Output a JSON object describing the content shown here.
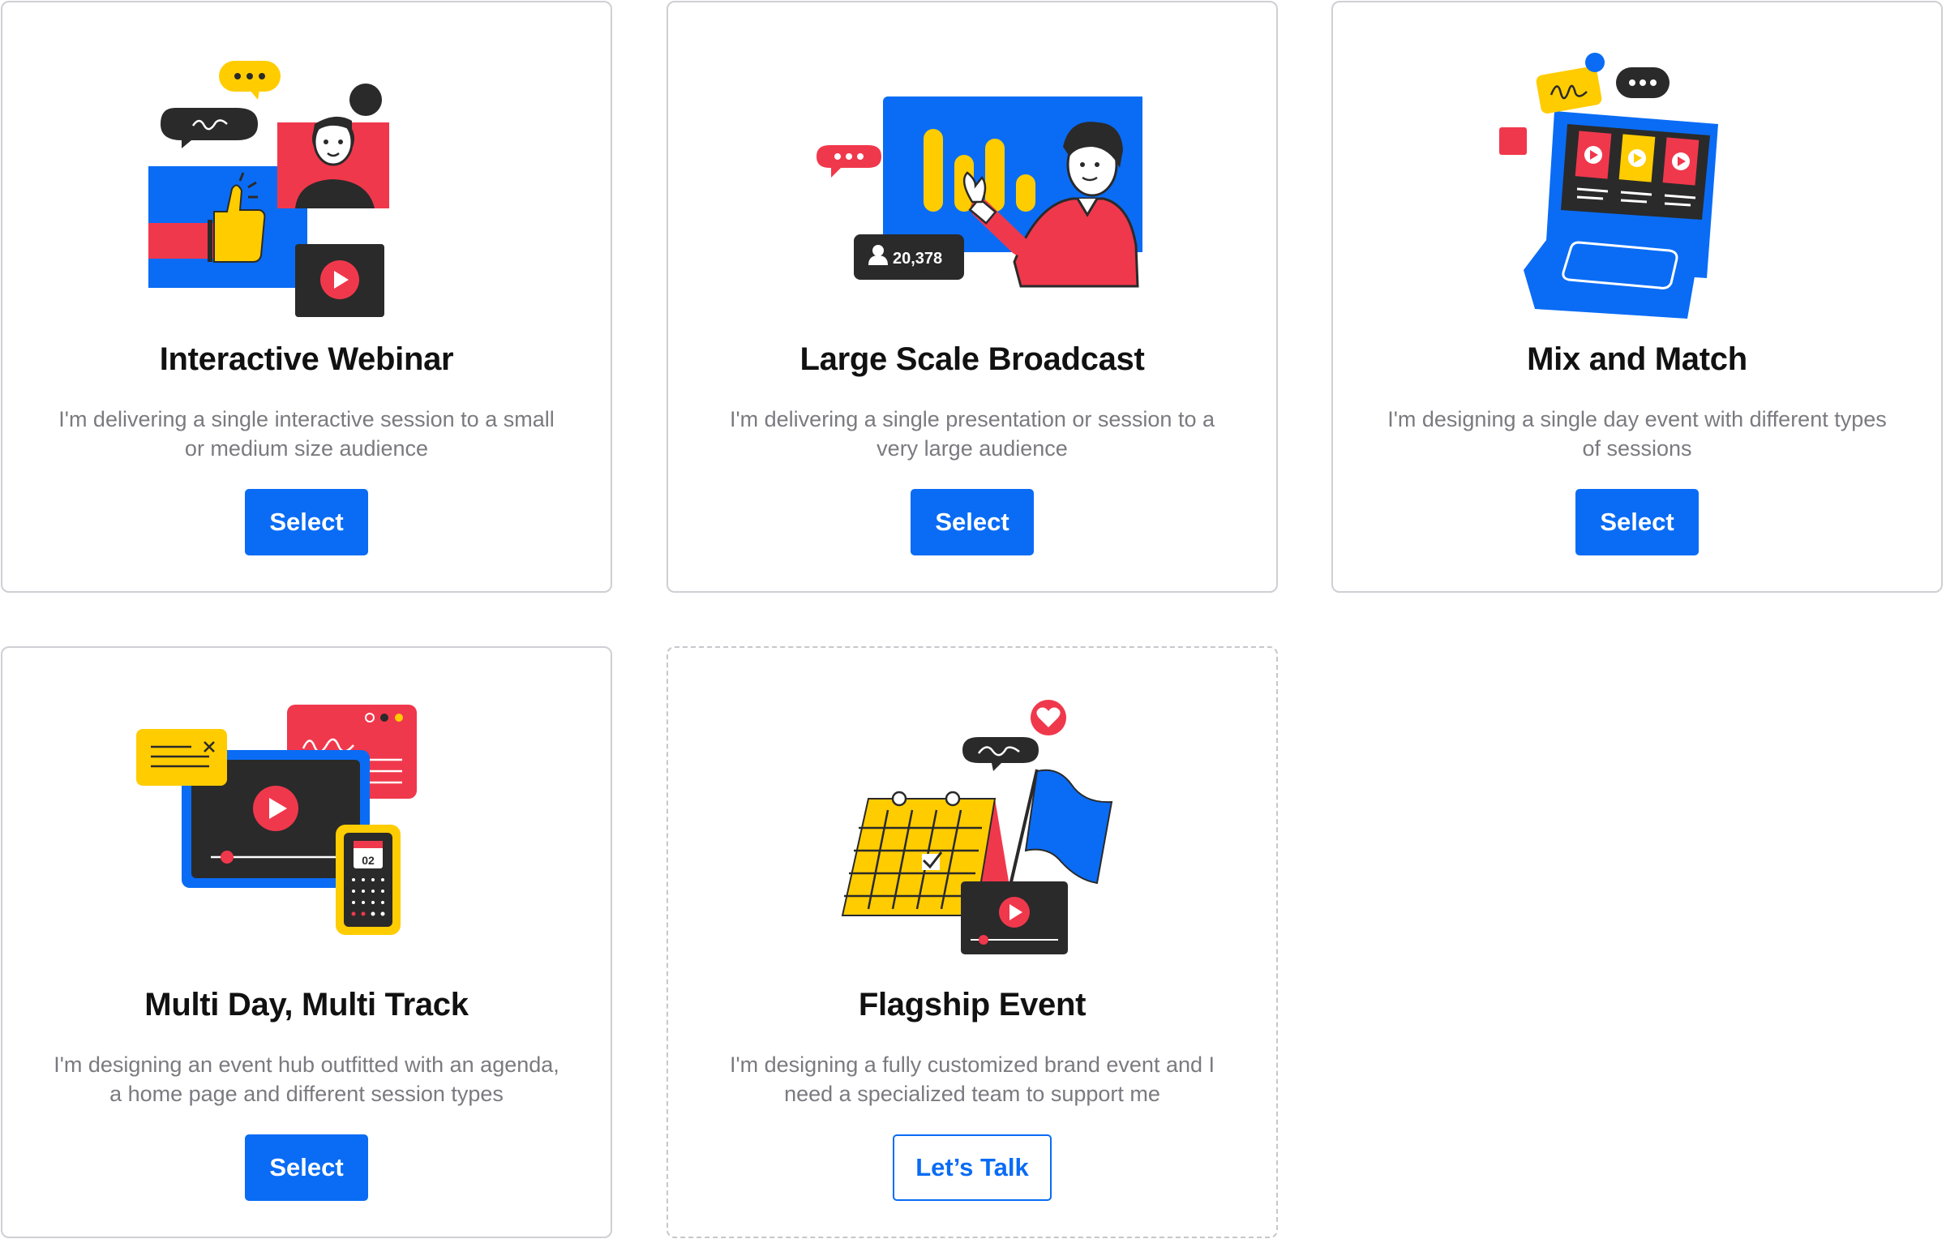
{
  "colors": {
    "accent": "#0a6cf5",
    "red": "#f0384c",
    "yellow": "#ffcc00",
    "dark": "#2a2a2a",
    "border": "#cfcfd4",
    "muted_text": "#7a7a80"
  },
  "cards": [
    {
      "title": "Interactive Webinar",
      "description": "I'm delivering a single interactive session to a small or medium size audience",
      "button": "Select",
      "illustration": "webinar-illustration"
    },
    {
      "title": "Large Scale Broadcast",
      "description": "I'm delivering a single presentation or session to a very large audience",
      "button": "Select",
      "illustration": "broadcast-illustration",
      "viewer_count": "20,378"
    },
    {
      "title": "Mix and Match",
      "description": "I'm designing a single day event with different types of sessions",
      "button": "Select",
      "illustration": "laptop-illustration"
    },
    {
      "title": "Multi Day, Multi Track",
      "description": "I'm designing an event hub outfitted with an agenda,  a home page and different session types",
      "button": "Select",
      "illustration": "multi-track-illustration",
      "calendar_day": "02"
    },
    {
      "title": "Flagship Event",
      "description": "I'm designing a fully customized brand event and I need a specialized team to support me",
      "button": "Let’s Talk",
      "illustration": "flagship-illustration"
    }
  ]
}
